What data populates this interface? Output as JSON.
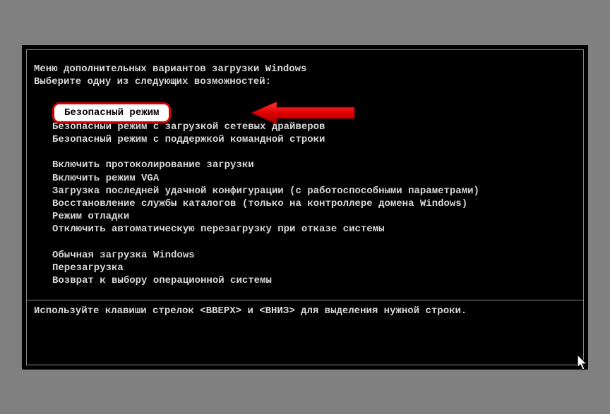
{
  "header": {
    "title": "Меню дополнительных вариантов загрузки Windows",
    "subtitle": "Выберите одну из следующих возможностей:"
  },
  "groups": [
    {
      "items": [
        {
          "label": "Безопасный режим",
          "selected": true
        },
        {
          "label": "Безопасный режим с загрузкой сетевых драйверов"
        },
        {
          "label": "Безопасный режим с поддержкой командной строки"
        }
      ]
    },
    {
      "items": [
        {
          "label": "Включить протоколирование загрузки"
        },
        {
          "label": "Включить режим VGA"
        },
        {
          "label": "Загрузка последней удачной конфигурации (с работоспособными параметрами)"
        },
        {
          "label": "Восстановление службы каталогов (только на контроллере домена Windows)"
        },
        {
          "label": "Режим отладки"
        },
        {
          "label": "Отключить автоматическую перезагрузку при отказе системы"
        }
      ]
    },
    {
      "items": [
        {
          "label": "Обычная загрузка Windows"
        },
        {
          "label": "Перезагрузка"
        },
        {
          "label": "Возврат к выбору операционной системы"
        }
      ]
    }
  ],
  "footer": "Используйте клавиши стрелок <ВВЕРХ> и <ВНИЗ> для выделения нужной строки.",
  "annotation": {
    "arrow_color": "#d00000",
    "highlight_border_color": "#d00000"
  }
}
